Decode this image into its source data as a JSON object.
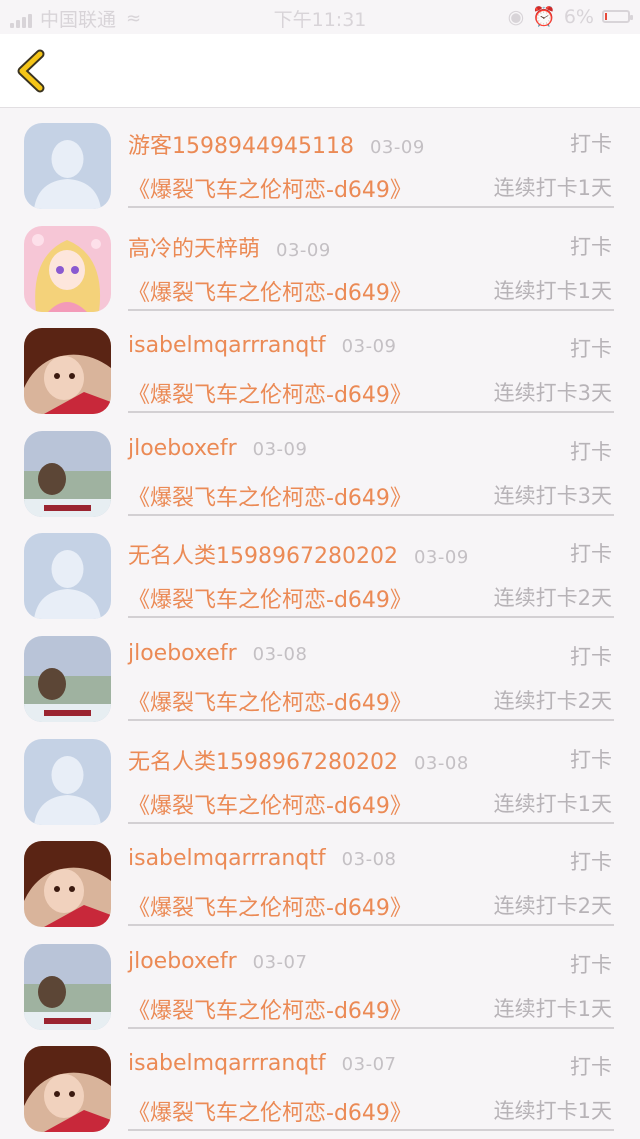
{
  "status_bar": {
    "carrier": "中国联通",
    "time": "下午11:31",
    "battery_percent": "6%",
    "battery_level": 0.06
  },
  "nav": {
    "back_icon": "chevron-left-icon",
    "accent_color": "#f5c518"
  },
  "colors": {
    "accent_orange": "#eb8a55",
    "muted_gray": "#b7b3b7"
  },
  "records": [
    {
      "user": "游客1598944945118",
      "date": "03-09",
      "action": "打卡",
      "book": "《爆裂飞车之伦柯恋-d649》",
      "streak": "连续打卡1天",
      "avatar": "default-avatar"
    },
    {
      "user": "高冷的天梓萌",
      "date": "03-09",
      "action": "打卡",
      "book": "《爆裂飞车之伦柯恋-d649》",
      "streak": "连续打卡1天",
      "avatar": "anime-girl-avatar"
    },
    {
      "user": "isabelmqarrranqtf",
      "date": "03-09",
      "action": "打卡",
      "book": "《爆裂飞车之伦柯恋-d649》",
      "streak": "连续打卡3天",
      "avatar": "photo-girl-avatar"
    },
    {
      "user": "jloeboxefr",
      "date": "03-09",
      "action": "打卡",
      "book": "《爆裂飞车之伦柯恋-d649》",
      "streak": "连续打卡3天",
      "avatar": "landscape-avatar"
    },
    {
      "user": "无名人类1598967280202",
      "date": "03-09",
      "action": "打卡",
      "book": "《爆裂飞车之伦柯恋-d649》",
      "streak": "连续打卡2天",
      "avatar": "default-avatar"
    },
    {
      "user": "jloeboxefr",
      "date": "03-08",
      "action": "打卡",
      "book": "《爆裂飞车之伦柯恋-d649》",
      "streak": "连续打卡2天",
      "avatar": "landscape-avatar"
    },
    {
      "user": "无名人类1598967280202",
      "date": "03-08",
      "action": "打卡",
      "book": "《爆裂飞车之伦柯恋-d649》",
      "streak": "连续打卡1天",
      "avatar": "default-avatar"
    },
    {
      "user": "isabelmqarrranqtf",
      "date": "03-08",
      "action": "打卡",
      "book": "《爆裂飞车之伦柯恋-d649》",
      "streak": "连续打卡2天",
      "avatar": "photo-girl-avatar"
    },
    {
      "user": "jloeboxefr",
      "date": "03-07",
      "action": "打卡",
      "book": "《爆裂飞车之伦柯恋-d649》",
      "streak": "连续打卡1天",
      "avatar": "landscape-avatar"
    },
    {
      "user": "isabelmqarrranqtf",
      "date": "03-07",
      "action": "打卡",
      "book": "《爆裂飞车之伦柯恋-d649》",
      "streak": "连续打卡1天",
      "avatar": "photo-girl-avatar"
    }
  ]
}
